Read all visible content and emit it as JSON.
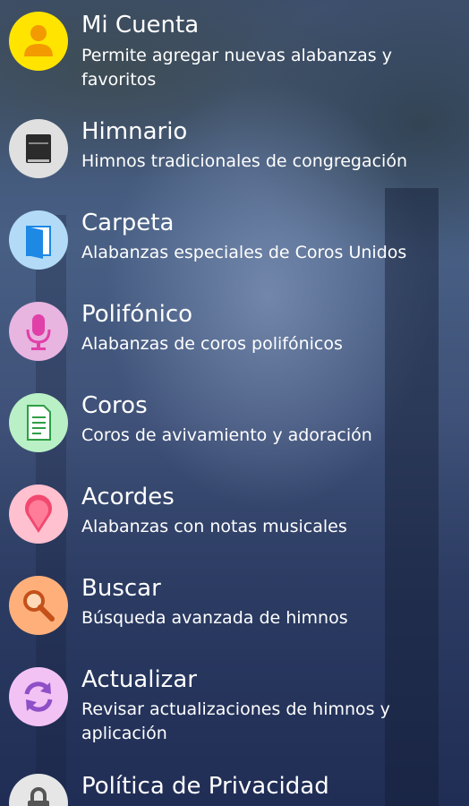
{
  "menu": {
    "items": [
      {
        "id": "mi-cuenta",
        "title": "Mi Cuenta",
        "subtitle": "Permite agregar nuevas alabanzas y favoritos",
        "icon": "user-icon",
        "icon_bg": "#ffe400"
      },
      {
        "id": "himnario",
        "title": "Himnario",
        "subtitle": "Himnos tradicionales de congregación",
        "icon": "book-icon",
        "icon_bg": "#e0e0e0"
      },
      {
        "id": "carpeta",
        "title": "Carpeta",
        "subtitle": "Alabanzas especiales de Coros Unidos",
        "icon": "folder-icon",
        "icon_bg": "#b3dbf7"
      },
      {
        "id": "polifonico",
        "title": "Polifónico",
        "subtitle": "Alabanzas de coros polifónicos",
        "icon": "microphone-icon",
        "icon_bg": "#e8b4e0"
      },
      {
        "id": "coros",
        "title": "Coros",
        "subtitle": "Coros de avivamiento y adoración",
        "icon": "document-icon",
        "icon_bg": "#b9f0c6"
      },
      {
        "id": "acordes",
        "title": "Acordes",
        "subtitle": "Alabanzas con notas musicales",
        "icon": "map-pin-icon",
        "icon_bg": "#ffc0cf"
      },
      {
        "id": "buscar",
        "title": "Buscar",
        "subtitle": "Búsqueda avanzada de himnos",
        "icon": "search-icon",
        "icon_bg": "#ffb07a"
      },
      {
        "id": "actualizar",
        "title": "Actualizar",
        "subtitle": "Revisar actualizaciones de himnos y aplicación",
        "icon": "refresh-icon",
        "icon_bg": "#f3c2f5"
      },
      {
        "id": "privacidad",
        "title": "Política de Privacidad",
        "subtitle": "",
        "icon": "lock-icon",
        "icon_bg": "#e6e6e6"
      }
    ]
  },
  "colors": {
    "text": "#ffffff",
    "background": "#3a4a6e"
  }
}
